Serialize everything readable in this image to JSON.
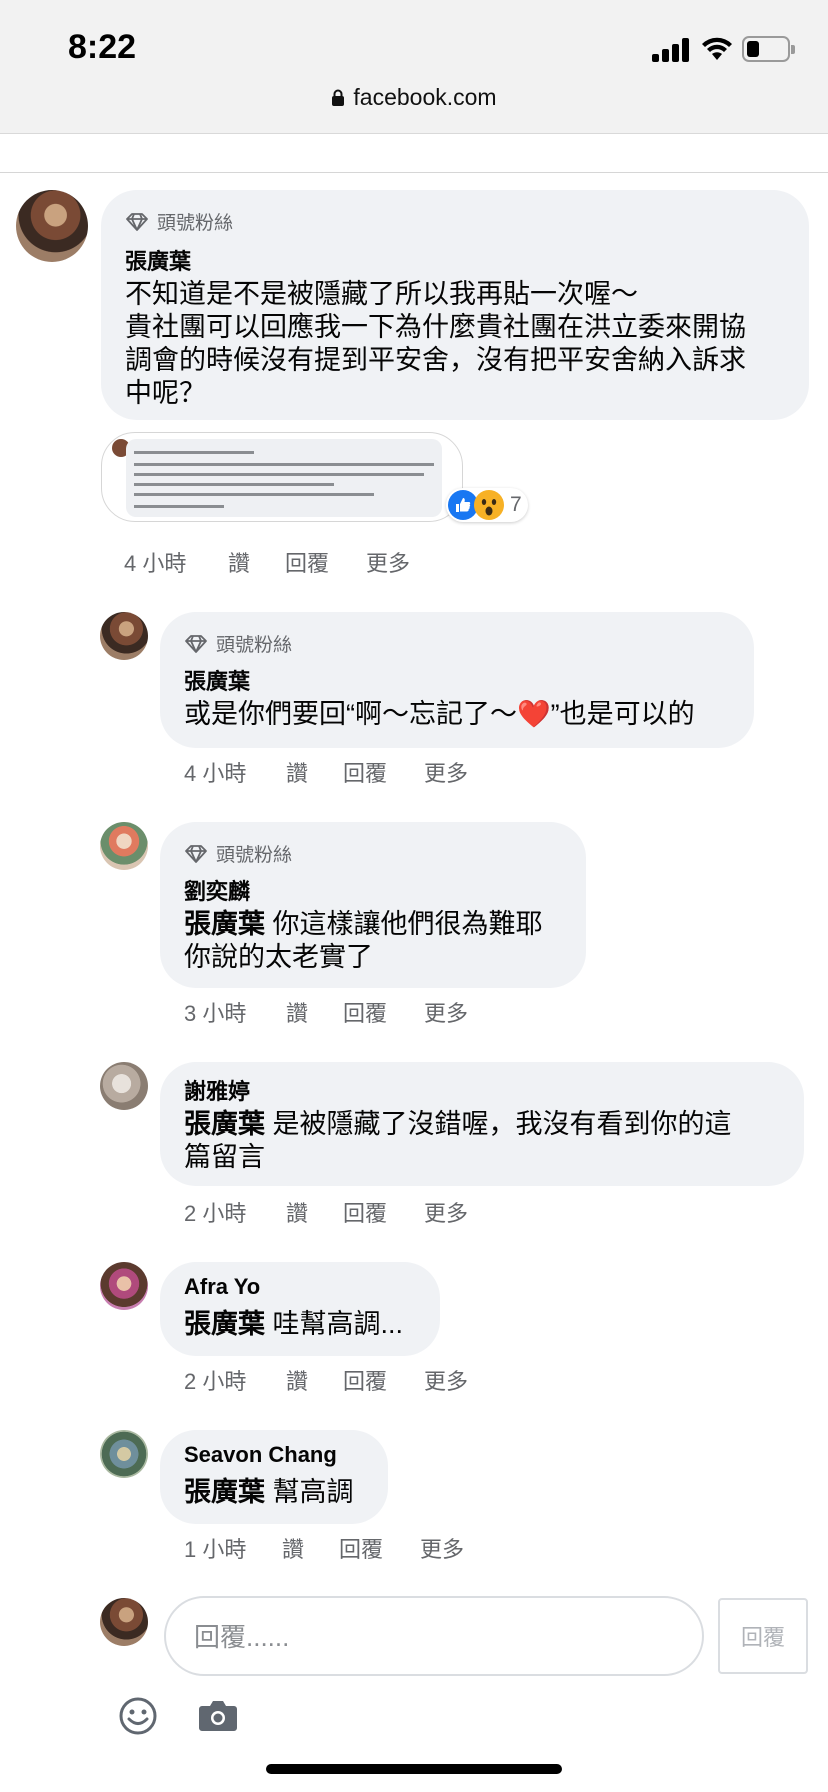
{
  "status_bar": {
    "time": "8:22"
  },
  "browser": {
    "url": "facebook.com"
  },
  "comments": [
    {
      "badge": "頭號粉絲",
      "author": "張廣葉",
      "text_lines": [
        "不知道是不是被隱藏了所以我再貼一次喔～",
        "貴社團可以回應我一下為什麼貴社團在洪立委來開協",
        "調會的時候沒有提到平安舍，沒有把平安舍納入訴求",
        "中呢？"
      ],
      "time": "4 小時",
      "reaction_count": "7"
    },
    {
      "badge": "頭號粉絲",
      "author": "張廣葉",
      "text": "或是你們要回“啊～忘記了～❤️”也是可以的",
      "time": "4 小時"
    },
    {
      "badge": "頭號粉絲",
      "author": "劉奕麟",
      "mention": "張廣葉",
      "text_lines": [
        "你這樣讓他們很為難耶",
        "你說的太老實了"
      ],
      "time": "3 小時"
    },
    {
      "author": "謝雅婷",
      "mention": "張廣葉",
      "text_lines": [
        "是被隱藏了沒錯喔，我沒有看到你的這",
        "篇留言"
      ],
      "time": "2 小時"
    },
    {
      "author": "Afra Yo",
      "mention": "張廣葉",
      "text": "哇幫高調...",
      "time": "2 小時"
    },
    {
      "author": "Seavon Chang",
      "mention": "張廣葉",
      "text": "幫高調",
      "time": "1 小時"
    }
  ],
  "actions": {
    "like": "讚",
    "reply": "回覆",
    "more": "更多"
  },
  "composer": {
    "placeholder": "回覆......",
    "send": "回覆"
  },
  "icons": [
    "lock-icon",
    "signal-icon",
    "wifi-icon",
    "battery-icon",
    "diamond-icon",
    "like-reaction-icon",
    "wow-reaction-icon",
    "emoji-icon",
    "camera-icon"
  ]
}
